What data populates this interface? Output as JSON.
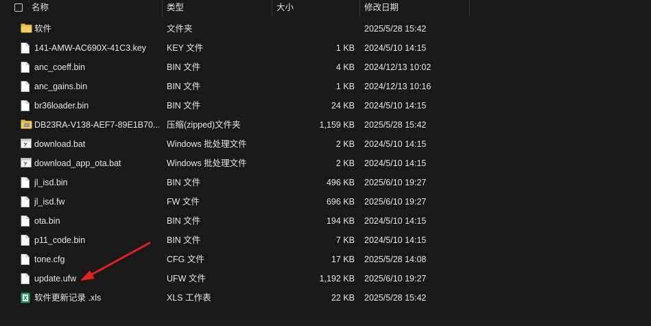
{
  "header": {
    "select_all": "",
    "col_name": "名称",
    "col_type": "类型",
    "col_size": "大小",
    "col_date": "修改日期"
  },
  "files": [
    {
      "icon": "folder-icon",
      "name": "软件",
      "type": "文件夹",
      "size": "",
      "date": "2025/5/28 15:42"
    },
    {
      "icon": "file-icon",
      "name": "141-AMW-AC690X-41C3.key",
      "type": "KEY 文件",
      "size": "1 KB",
      "date": "2024/5/10 14:15"
    },
    {
      "icon": "file-icon",
      "name": "anc_coeff.bin",
      "type": "BIN 文件",
      "size": "4 KB",
      "date": "2024/12/13 10:02"
    },
    {
      "icon": "file-icon",
      "name": "anc_gains.bin",
      "type": "BIN 文件",
      "size": "1 KB",
      "date": "2024/12/13 10:16"
    },
    {
      "icon": "file-icon",
      "name": "br36loader.bin",
      "type": "BIN 文件",
      "size": "24 KB",
      "date": "2024/5/10 14:15"
    },
    {
      "icon": "zip-folder-icon",
      "name": "DB23RA-V138-AEF7-89E1B70...",
      "type": "压缩(zipped)文件夹",
      "size": "1,159 KB",
      "date": "2025/5/28 15:42"
    },
    {
      "icon": "batch-file-icon",
      "name": "download.bat",
      "type": "Windows 批处理文件",
      "size": "2 KB",
      "date": "2024/5/10 14:15"
    },
    {
      "icon": "batch-file-icon",
      "name": "download_app_ota.bat",
      "type": "Windows 批处理文件",
      "size": "2 KB",
      "date": "2024/5/10 14:15"
    },
    {
      "icon": "file-icon",
      "name": "jl_isd.bin",
      "type": "BIN 文件",
      "size": "496 KB",
      "date": "2025/6/10 19:27"
    },
    {
      "icon": "file-icon",
      "name": "jl_isd.fw",
      "type": "FW 文件",
      "size": "696 KB",
      "date": "2025/6/10 19:27"
    },
    {
      "icon": "file-icon",
      "name": "ota.bin",
      "type": "BIN 文件",
      "size": "194 KB",
      "date": "2024/5/10 14:15"
    },
    {
      "icon": "file-icon",
      "name": "p11_code.bin",
      "type": "BIN 文件",
      "size": "7 KB",
      "date": "2024/5/10 14:15"
    },
    {
      "icon": "file-icon",
      "name": "tone.cfg",
      "type": "CFG 文件",
      "size": "17 KB",
      "date": "2025/5/28 14:08"
    },
    {
      "icon": "file-icon",
      "name": "update.ufw",
      "type": "UFW 文件",
      "size": "1,192 KB",
      "date": "2025/6/10 19:27"
    },
    {
      "icon": "excel-file-icon",
      "name": "软件更新记录 .xls",
      "type": "XLS 工作表",
      "size": "22 KB",
      "date": "2025/5/28 15:42"
    }
  ],
  "colors": {
    "background": "#191919",
    "text": "#e6e6e6",
    "folder": "#f2c84b",
    "annotation_arrow": "#e0211d",
    "excel": "#1f9d60"
  },
  "annotation": {
    "type": "arrow",
    "points_to": "update.ufw"
  }
}
